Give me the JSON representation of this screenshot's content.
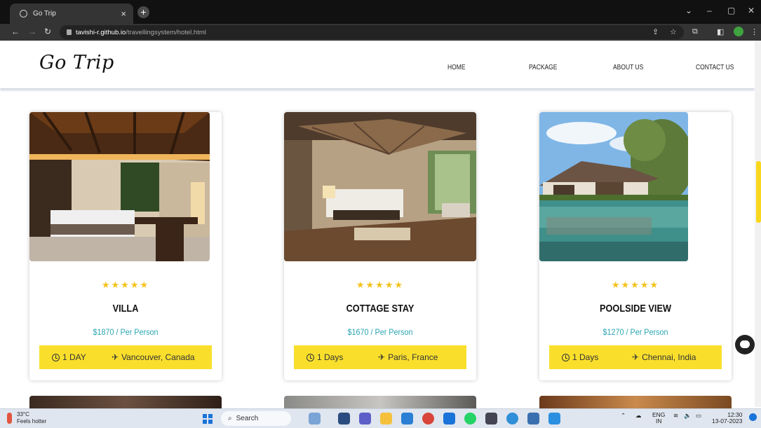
{
  "browser": {
    "tab_title": "Go Trip",
    "tab_close": "×",
    "new_tab": "+",
    "url_host": "tavishi-r.github.io",
    "url_path": "/travellingsystem/hotel.html",
    "window_min": "–",
    "window_max": "▢",
    "window_close": "✕"
  },
  "site": {
    "logo": "Go Trip",
    "nav": [
      "HOME",
      "PACKAGE",
      "ABOUT US",
      "CONTACT US"
    ]
  },
  "cards": [
    {
      "title": "VILLA",
      "rating": 5,
      "stars": "★★★★★",
      "price": "$1870 / Per Person",
      "duration": "1 DAY",
      "location": "Vancouver, Canada"
    },
    {
      "title": "COTTAGE STAY",
      "rating": 5,
      "stars": "★★★★★",
      "price": "$1670 / Per Person",
      "duration": "1 Days",
      "location": "Paris, France"
    },
    {
      "title": "POOLSIDE VIEW",
      "rating": 5,
      "stars": "★★★★★",
      "price": "$1270 / Per Person",
      "duration": "1 Days",
      "location": "Chennai, India"
    }
  ],
  "icons": {
    "duration": "clock-icon",
    "location": "airplane-icon",
    "plane_glyph": "✈"
  },
  "taskbar": {
    "temperature": "33°C",
    "weather_text": "Feels hotter",
    "search_label": "Search",
    "lang_top": "ENG",
    "lang_bottom": "IN",
    "time": "12:30",
    "date": "13-07-2023"
  },
  "colors": {
    "accent_yellow": "#f9df2c",
    "price_teal": "#2aa7b2",
    "star_gold": "#f4c21b"
  }
}
